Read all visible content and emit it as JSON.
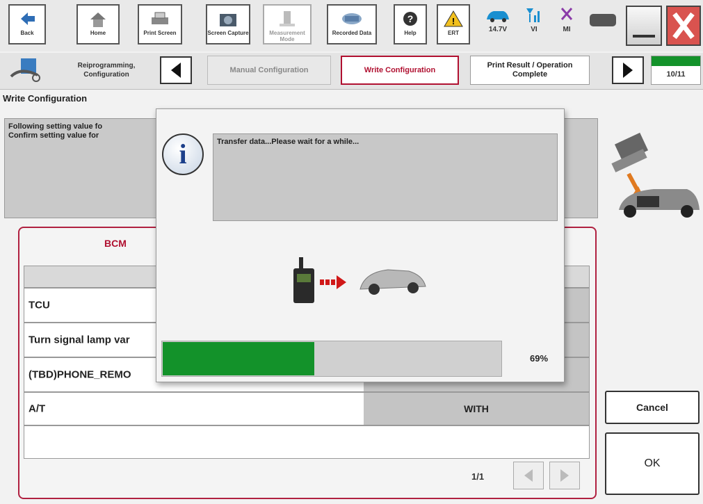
{
  "toolbar": {
    "buttons": [
      {
        "label": "Back",
        "icon": "back-arrow-icon"
      },
      {
        "label": "Home",
        "icon": "home-icon"
      },
      {
        "label": "Print Screen",
        "icon": "printer-icon"
      },
      {
        "label": "Screen Capture",
        "icon": "camera-icon"
      },
      {
        "label": "Measurement Mode",
        "icon": "measurement-icon"
      },
      {
        "label": "Recorded Data",
        "icon": "recorded-data-icon"
      },
      {
        "label": "Help",
        "icon": "help-icon"
      },
      {
        "label": "ERT",
        "icon": "warning-icon"
      }
    ],
    "status": {
      "voltage": "14.7V",
      "vi": "VI",
      "mi": "MI"
    }
  },
  "steps": {
    "section": "Reiprogramming, Configuration",
    "prev": "Manual Configuration",
    "current": "Write Configuration",
    "next": "Print Result / Operation Complete",
    "counter": "10/11"
  },
  "page": {
    "title": "Write Configuration",
    "message_line1": "Following setting value fo",
    "message_line2": "Confirm setting value for"
  },
  "panel": {
    "tab": "BCM",
    "rows": [
      {
        "label": "TCU",
        "value": ""
      },
      {
        "label": "Turn signal lamp var",
        "value": ""
      },
      {
        "label": "(TBD)PHONE_REMO",
        "value": ""
      },
      {
        "label": "A/T",
        "value": "WITH"
      }
    ],
    "pager": "1/1"
  },
  "buttons": {
    "cancel": "Cancel",
    "ok": "OK"
  },
  "dialog": {
    "message": "Transfer data...Please wait for a while...",
    "progress_percent": 69,
    "progress_label": "69%"
  },
  "colors": {
    "progress": "#13922a",
    "accent": "#b01030",
    "close": "#d9534f"
  }
}
